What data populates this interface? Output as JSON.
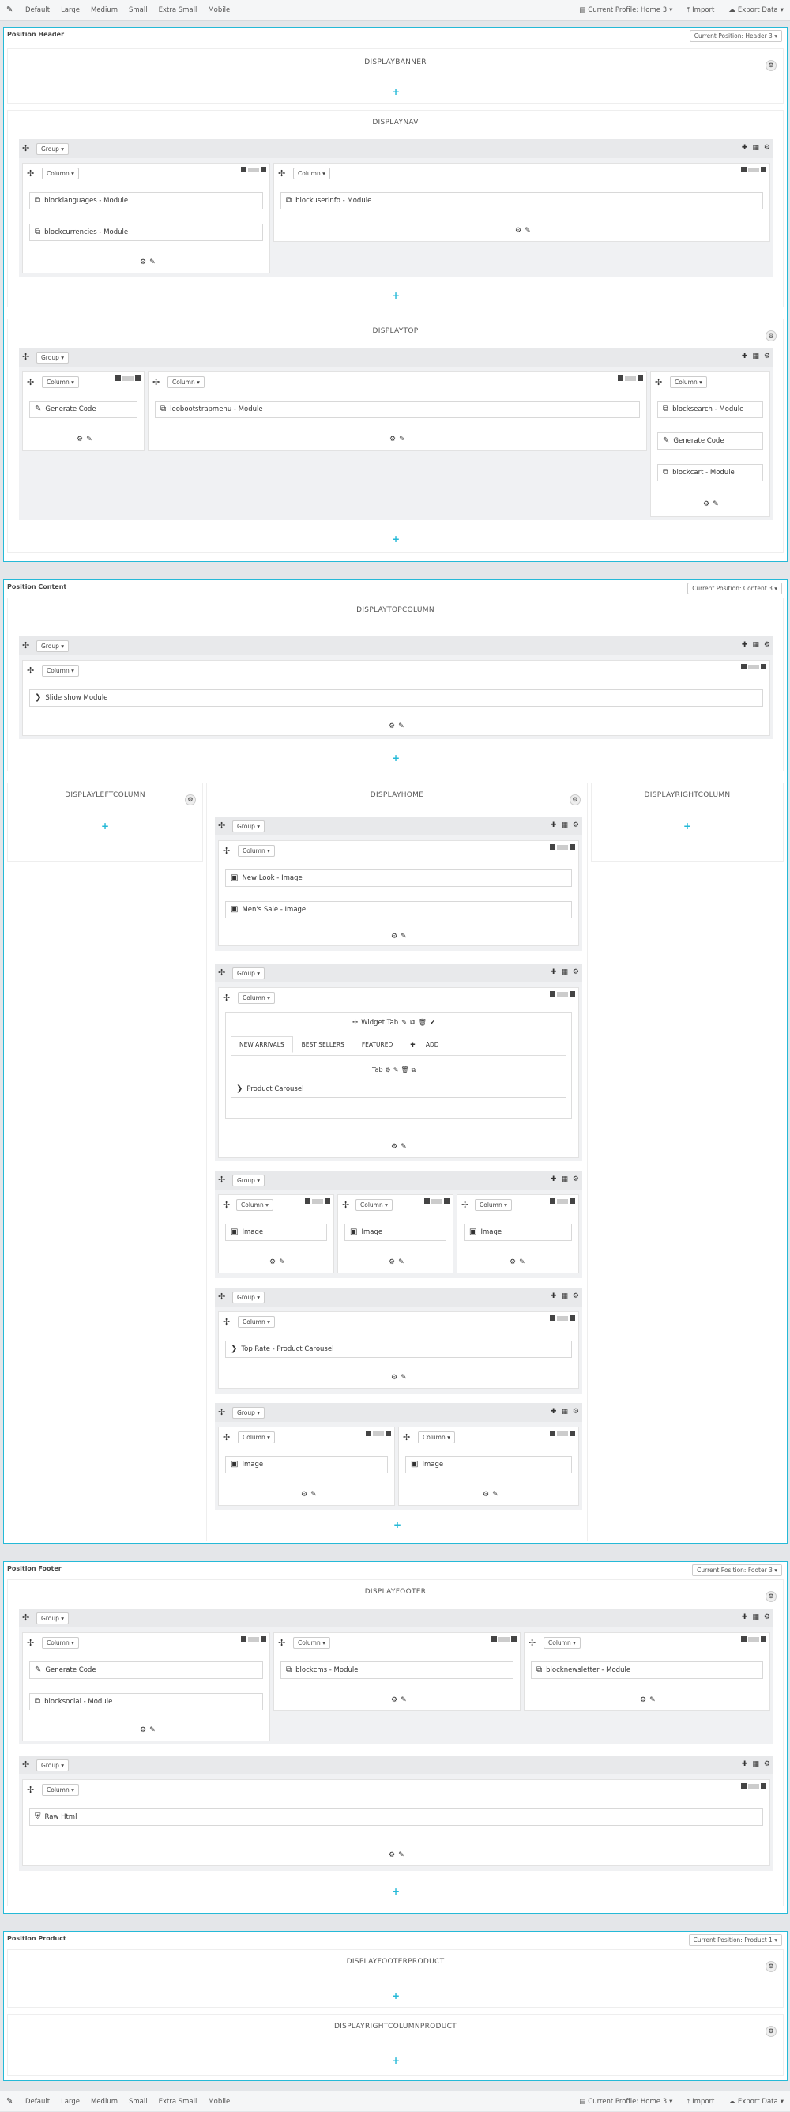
{
  "toolbar": {
    "devices": [
      "Default",
      "Large",
      "Medium",
      "Small",
      "Extra Small",
      "Mobile"
    ],
    "profile": "Current Profile: Home 3",
    "import": "Import",
    "export": "Export Data"
  },
  "common": {
    "group": "Group",
    "column": "Column",
    "add_icon": "+",
    "gear_icon": "⚙",
    "edit_icon": "✎",
    "move_icon": "✢"
  },
  "header": {
    "title": "Position Header",
    "current": "Current Position: Header 3",
    "displaybanner": "DISPLAYBANNER",
    "displaynav": "DISPLAYNAV",
    "nav_mods": [
      "blocklanguages - Module",
      "blockcurrencies - Module",
      "blockuserinfo - Module"
    ],
    "displaytop": "DISPLAYTOP",
    "top_mods": [
      "Generate Code",
      "leobootstrapmenu - Module",
      "blocksearch - Module",
      "Generate Code",
      "blockcart - Module"
    ]
  },
  "content": {
    "title": "Position Content",
    "current": "Current Position: Content 3",
    "displaytopcolumn": "DISPLAYTOPCOLUMN",
    "slideshow": "Slide show Module",
    "displayleftcolumn": "DISPLAYLEFTCOLUMN",
    "displayhome": "DISPLAYHOME",
    "displayrightcolumn": "DISPLAYRIGHTCOLUMN",
    "newlook": "New Look - Image",
    "mensale": "Men's Sale - Image",
    "widget_tab": "Widget Tab",
    "tabs": [
      "NEW ARRIVALS",
      "BEST SELLERS",
      "FEATURED",
      "ADD"
    ],
    "tab_label": "Tab",
    "product_carousel": "Product Carousel",
    "image": "Image",
    "toprate": "Top Rate - Product Carousel"
  },
  "footer": {
    "title": "Position Footer",
    "current": "Current Position: Footer 3",
    "displayfooter": "DISPLAYFOOTER",
    "mods": [
      "Generate Code",
      "blocksocial - Module",
      "blockcms - Module",
      "blocknewsletter - Module"
    ],
    "rawhtml": "Raw Html"
  },
  "product": {
    "title": "Position Product",
    "current": "Current Position: Product 1",
    "footerproduct": "DISPLAYFOOTERPRODUCT",
    "rightcolumnproduct": "DISPLAYRIGHTCOLUMNPRODUCT"
  }
}
